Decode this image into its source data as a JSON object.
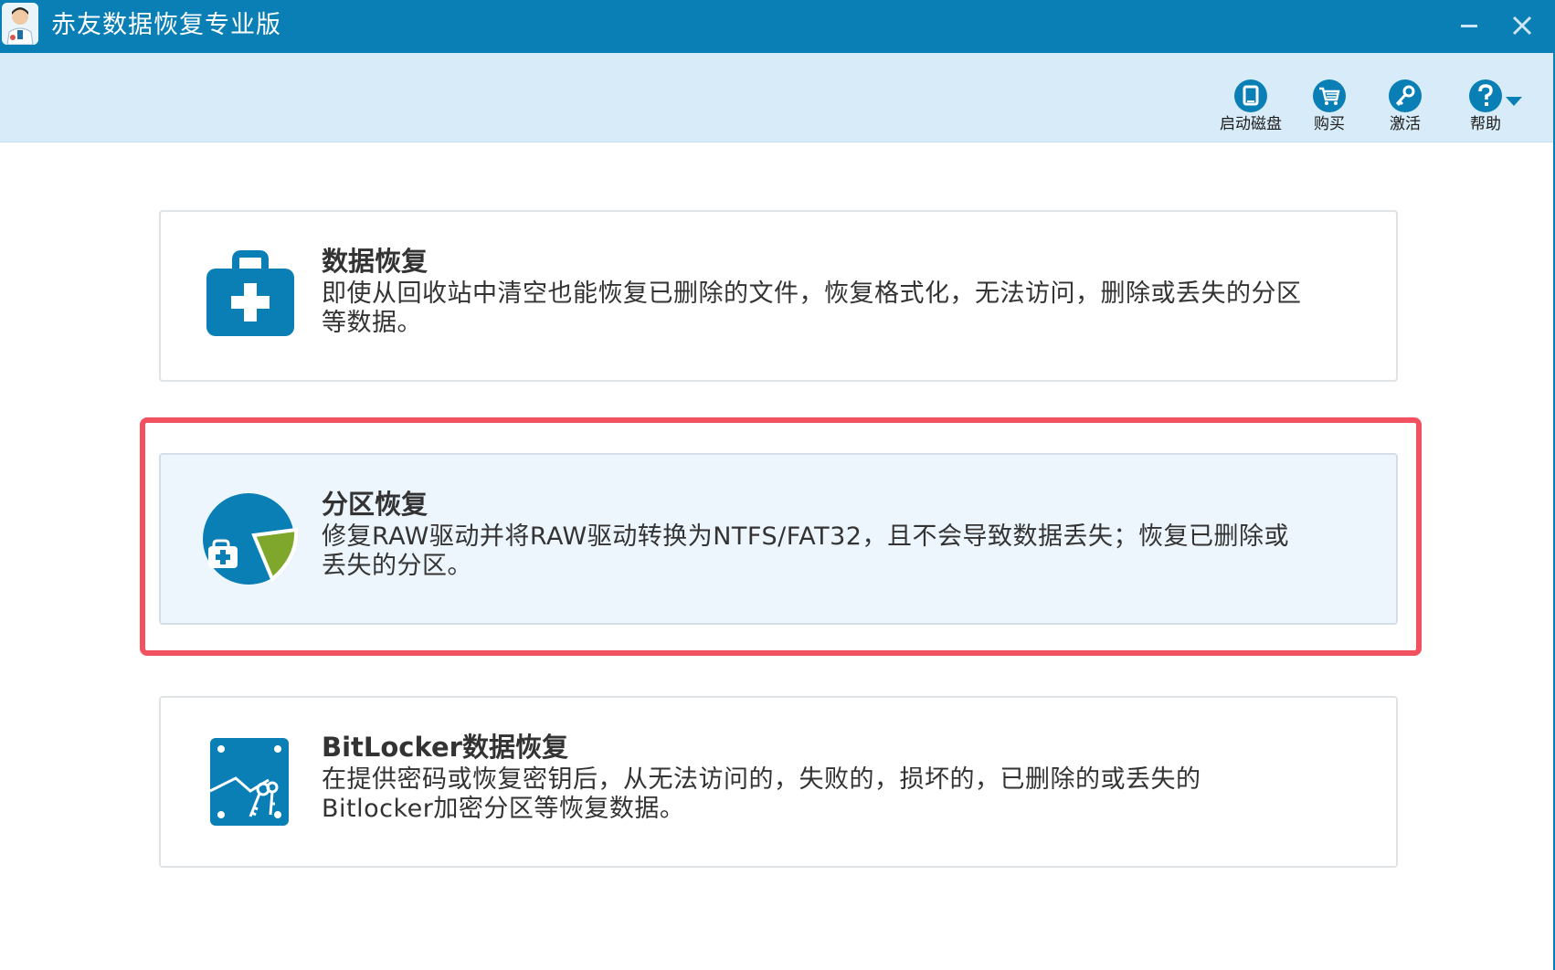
{
  "window": {
    "title": "赤友数据恢复专业版",
    "accent_color": "#0a7fb5",
    "toolbar_bg": "#d7ebf8",
    "highlight_color": "#f2525f",
    "controls": {
      "minimize_icon": "minimize-icon",
      "close_icon": "close-icon"
    }
  },
  "toolbar": {
    "items": [
      {
        "label": "启动磁盘",
        "icon": "boot-disk-icon"
      },
      {
        "label": "购买",
        "icon": "cart-icon"
      },
      {
        "label": "激活",
        "icon": "key-icon"
      },
      {
        "label": "帮助",
        "icon": "help-icon"
      }
    ]
  },
  "options": [
    {
      "title": "数据恢复",
      "description": "即使从回收站中清空也能恢复已删除的文件，恢复格式化，无法访问，删除或丢失的分区等数据。",
      "icon": "medical-kit-icon",
      "selected": false
    },
    {
      "title": "分区恢复",
      "description": "修复RAW驱动并将RAW驱动转换为NTFS/FAT32，且不会导致数据丢失；恢复已删除或丢失的分区。",
      "icon": "partition-pie-icon",
      "selected": true
    },
    {
      "title": "BitLocker数据恢复",
      "description": "在提供密码或恢复密钥后，从无法访问的，失败的，损坏的，已删除的或丢失的Bitlocker加密分区等恢复数据。",
      "icon": "bitlocker-keys-icon",
      "selected": false
    }
  ]
}
